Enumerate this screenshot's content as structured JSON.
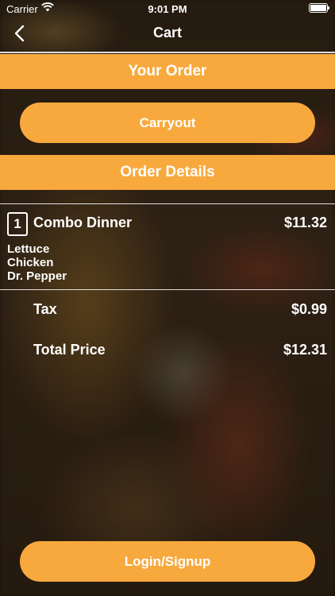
{
  "status_bar": {
    "carrier": "Carrier",
    "time": "9:01 PM",
    "battery_level": 1.0
  },
  "nav": {
    "title": "Cart"
  },
  "order": {
    "heading": "Your Order",
    "mode_button": "Carryout",
    "details_heading": "Order Details",
    "item": {
      "quantity": "1",
      "name": "Combo Dinner",
      "price": "$11.32",
      "modifiers": [
        "Lettuce",
        "Chicken",
        "Dr. Pepper"
      ]
    },
    "tax_label": "Tax",
    "tax_value": "$0.99",
    "total_label": "Total Price",
    "total_value": "$12.31"
  },
  "login_button": "Login/Signup",
  "colors": {
    "accent": "#f8a93d"
  }
}
